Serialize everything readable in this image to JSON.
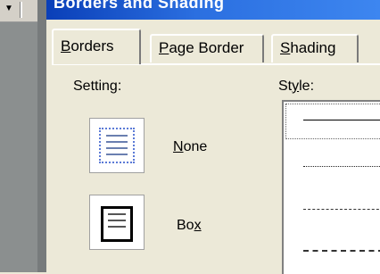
{
  "dialog": {
    "title": "Borders and Shading"
  },
  "tabs": [
    {
      "label_pre": "",
      "label_ul": "B",
      "label_post": "orders"
    },
    {
      "label_pre": "",
      "label_ul": "P",
      "label_post": "age Border"
    },
    {
      "label_pre": "",
      "label_ul": "S",
      "label_post": "hading"
    }
  ],
  "setting": {
    "label": "Setting:",
    "options": [
      {
        "label_pre": "",
        "label_ul": "N",
        "label_post": "one",
        "icon": "no-border-icon",
        "selected": true
      },
      {
        "label_pre": "Bo",
        "label_ul": "x",
        "label_post": "",
        "icon": "box-border-icon",
        "selected": false
      }
    ]
  },
  "style": {
    "label_pre": "St",
    "label_ul": "y",
    "label_post": "le:",
    "items": [
      "solid",
      "dotted",
      "dashed-small",
      "dashed-large"
    ],
    "selected_index": 0
  }
}
